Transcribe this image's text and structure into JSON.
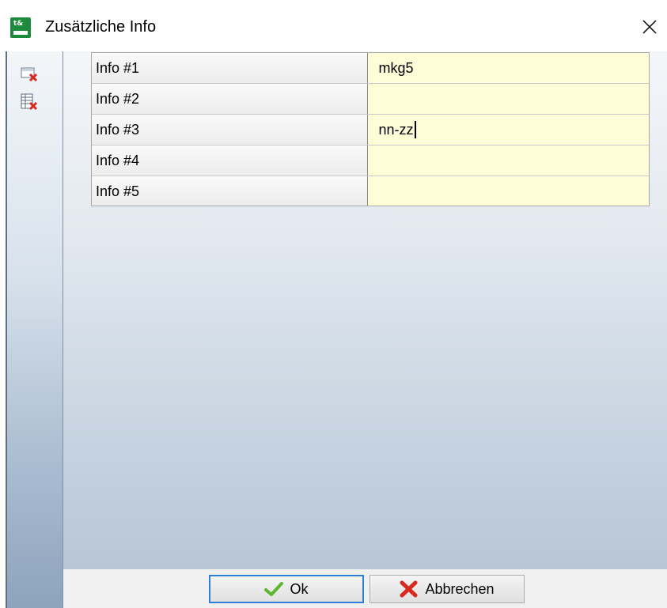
{
  "window": {
    "title": "Zusätzliche Info",
    "app_icon_text": "t&"
  },
  "toolbar": {
    "buttons": [
      {
        "icon": "delete-field-icon"
      },
      {
        "icon": "delete-all-icon"
      }
    ]
  },
  "grid": {
    "rows": [
      {
        "label": "Info #1",
        "value": "mkg5"
      },
      {
        "label": "Info #2",
        "value": ""
      },
      {
        "label": "Info #3",
        "value": "nn-zz"
      },
      {
        "label": "Info #4",
        "value": ""
      },
      {
        "label": "Info #5",
        "value": ""
      }
    ]
  },
  "buttons": {
    "ok_label": "Ok",
    "cancel_label": "Abbrechen"
  },
  "colors": {
    "value_cell_bg": "#fffdd8",
    "focus_border": "#2f7fd8",
    "ok_check": "#5cb82f",
    "cancel_x": "#d62a1e"
  }
}
